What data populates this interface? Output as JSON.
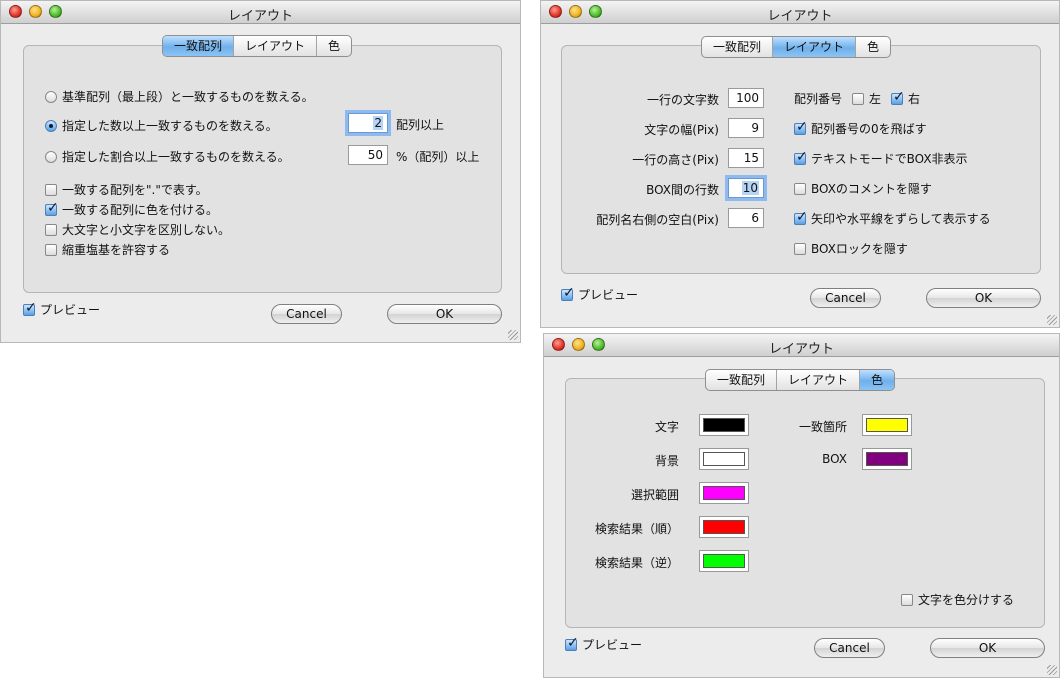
{
  "window_title": "レイアウト",
  "tabs": [
    "一致配列",
    "レイアウト",
    "色"
  ],
  "buttons": {
    "cancel": "Cancel",
    "ok": "OK"
  },
  "preview_label": "プレビュー",
  "preview_checked": true,
  "match_window": {
    "active_tab": 0,
    "radio_options": [
      {
        "label": "基準配列（最上段）と一致するものを数える。",
        "selected": false
      },
      {
        "label": "指定した数以上一致するものを数える。",
        "selected": true
      },
      {
        "label": "指定した割合以上一致するものを数える。",
        "selected": false
      }
    ],
    "count_value": "2",
    "count_suffix": "配列以上",
    "percent_value": "50",
    "percent_suffix": "%（配列）以上",
    "checkboxes": [
      {
        "label": "一致する配列を\".\"で表す。",
        "checked": false
      },
      {
        "label": "一致する配列に色を付ける。",
        "checked": true
      },
      {
        "label": "大文字と小文字を区別しない。",
        "checked": false
      },
      {
        "label": "縮重塩基を許容する",
        "checked": false
      }
    ]
  },
  "layout_window": {
    "active_tab": 1,
    "fields": [
      {
        "label": "一行の文字数",
        "value": "100"
      },
      {
        "label": "文字の幅(Pix)",
        "value": "9"
      },
      {
        "label": "一行の高さ(Pix)",
        "value": "15"
      },
      {
        "label": "BOX間の行数",
        "value": "10"
      },
      {
        "label": "配列名右側の空白(Pix)",
        "value": "6"
      }
    ],
    "seq_number_label": "配列番号",
    "seq_left_label": "左",
    "seq_left_checked": false,
    "seq_right_label": "右",
    "seq_right_checked": true,
    "checkboxes": [
      {
        "label": "配列番号の0を飛ばす",
        "checked": true
      },
      {
        "label": "テキストモードでBOX非表示",
        "checked": true
      },
      {
        "label": "BOXのコメントを隠す",
        "checked": false
      },
      {
        "label": "矢印や水平線をずらして表示する",
        "checked": true
      },
      {
        "label": "BOXロックを隠す",
        "checked": false
      }
    ]
  },
  "color_window": {
    "active_tab": 2,
    "left_colors": [
      {
        "label": "文字",
        "color": "#000000"
      },
      {
        "label": "背景",
        "color": "#ffffff"
      },
      {
        "label": "選択範囲",
        "color": "#ff00ff"
      },
      {
        "label": "検索結果（順）",
        "color": "#ff0000"
      },
      {
        "label": "検索結果（逆）",
        "color": "#00ff00"
      }
    ],
    "right_colors": [
      {
        "label": "一致箇所",
        "color": "#ffff00"
      },
      {
        "label": "BOX",
        "color": "#800080"
      }
    ],
    "color_text_label": "文字を色分けする",
    "color_text_checked": false
  }
}
